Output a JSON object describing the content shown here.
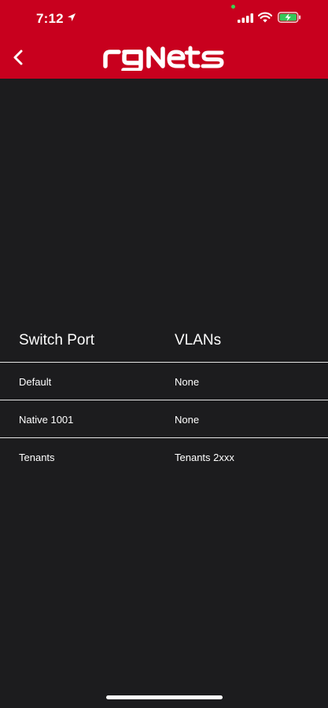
{
  "status_bar": {
    "time": "7:12"
  },
  "header": {
    "logo_text": "rgNets",
    "brand_color": "#c8001e"
  },
  "table": {
    "headers": [
      "Switch Port",
      "VLANs"
    ],
    "rows": [
      [
        "Default",
        "None"
      ],
      [
        "Native 1001",
        "None"
      ],
      [
        "Tenants",
        "Tenants 2xxx"
      ]
    ]
  },
  "icons": [
    "location-arrow-icon",
    "signal-icon",
    "wifi-icon",
    "battery-charging-icon",
    "back-chevron-icon"
  ]
}
